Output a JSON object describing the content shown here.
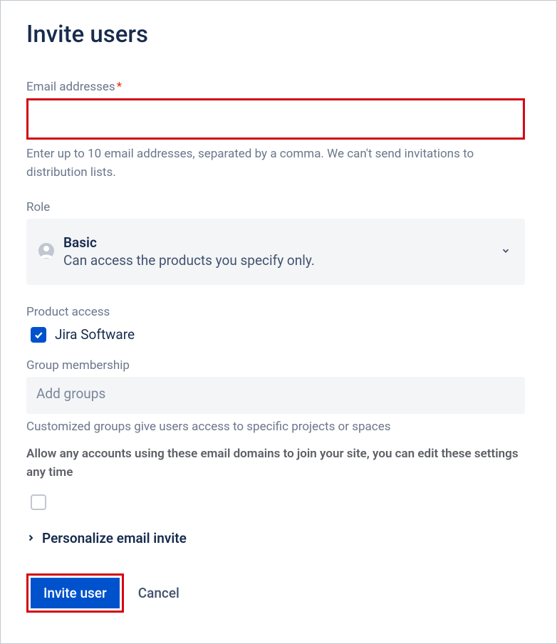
{
  "title": "Invite users",
  "email": {
    "label": "Email addresses",
    "required_marker": "*",
    "value": "",
    "helper": "Enter up to 10 email addresses, separated by a comma. We can't send invitations to distribution lists."
  },
  "role": {
    "label": "Role",
    "selected_title": "Basic",
    "selected_desc": "Can access the products you specify only."
  },
  "product_access": {
    "label": "Product access",
    "items": [
      {
        "label": "Jira Software",
        "checked": true
      }
    ]
  },
  "group_membership": {
    "label": "Group membership",
    "placeholder": "Add groups",
    "helper": "Customized groups give users access to specific projects or spaces"
  },
  "allow_domains": {
    "text": "Allow any accounts using these email domains to join your site, you can edit these settings any time",
    "checked": false
  },
  "personalize": {
    "label": "Personalize email invite"
  },
  "actions": {
    "invite": "Invite   user",
    "cancel": "Cancel"
  },
  "colors": {
    "primary": "#0052cc",
    "highlight_border": "#d40511",
    "text": "#172b4d",
    "muted": "#6b778c"
  }
}
